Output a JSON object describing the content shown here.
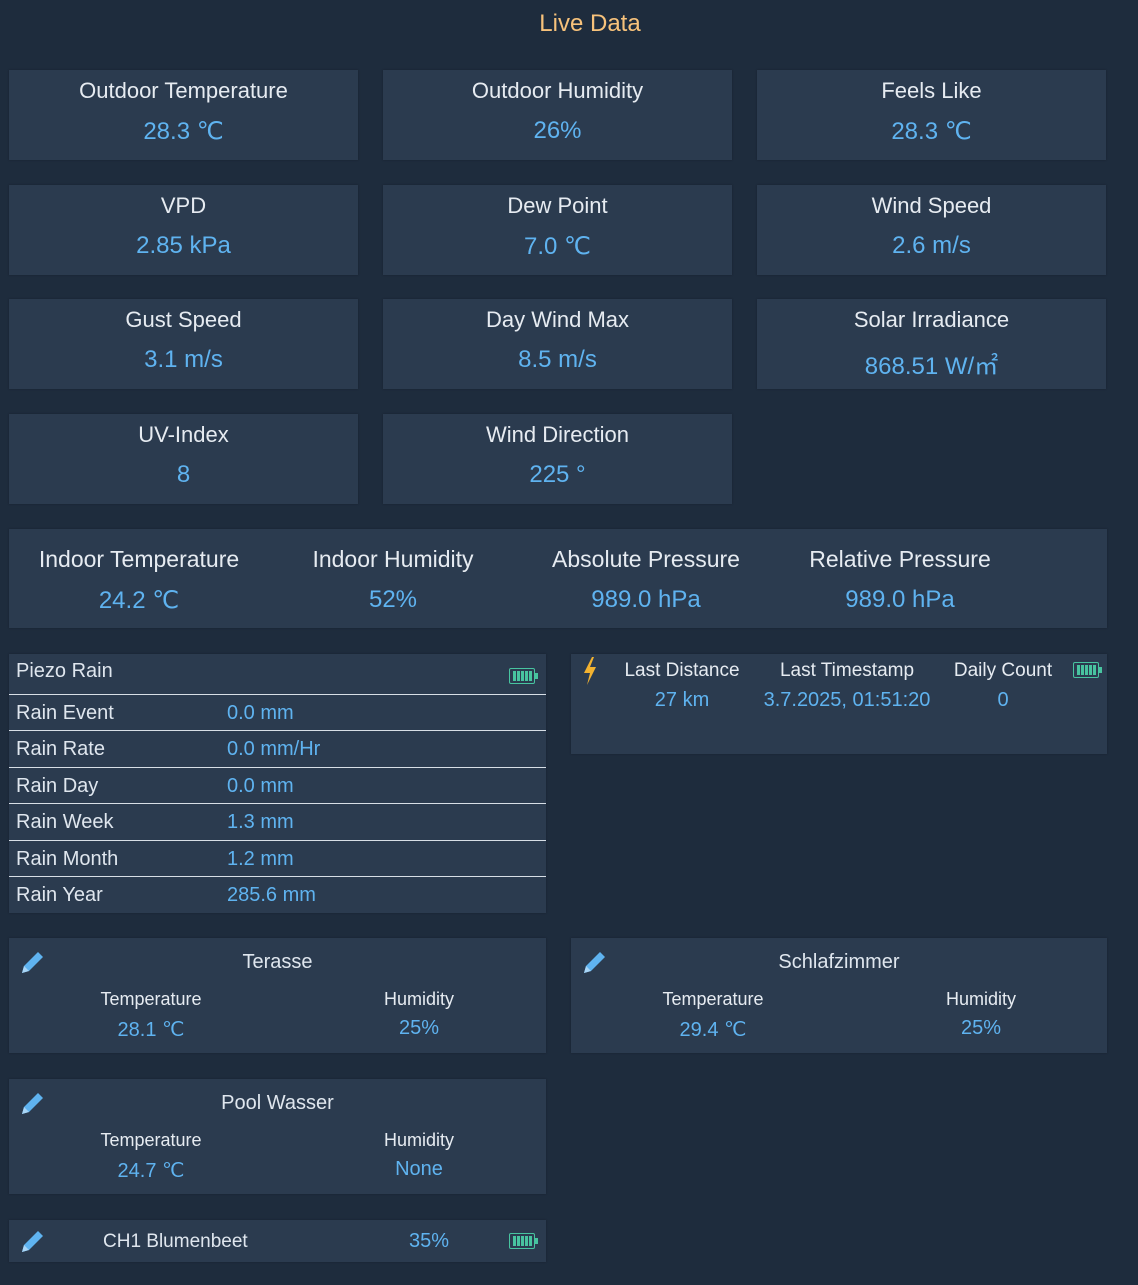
{
  "page_title": "Live Data",
  "tiles": [
    {
      "label": "Outdoor Temperature",
      "value": "28.3 ℃"
    },
    {
      "label": "Outdoor Humidity",
      "value": "26%"
    },
    {
      "label": "Feels Like",
      "value": "28.3 ℃"
    },
    {
      "label": "VPD",
      "value": "2.85 kPa"
    },
    {
      "label": "Dew Point",
      "value": "7.0 ℃"
    },
    {
      "label": "Wind Speed",
      "value": "2.6 m/s"
    },
    {
      "label": "Gust Speed",
      "value": "3.1 m/s"
    },
    {
      "label": "Day Wind Max",
      "value": "8.5 m/s"
    },
    {
      "label": "Solar Irradiance",
      "value": "868.51 W/㎡"
    },
    {
      "label": "UV-Index",
      "value": "8"
    },
    {
      "label": "Wind Direction",
      "value": "225 °"
    }
  ],
  "indoor": [
    {
      "label": "Indoor Temperature",
      "value": "24.2 ℃"
    },
    {
      "label": "Indoor Humidity",
      "value": "52%"
    },
    {
      "label": "Absolute Pressure",
      "value": "989.0 hPa"
    },
    {
      "label": "Relative Pressure",
      "value": "989.0 hPa"
    }
  ],
  "rain": {
    "title": "Piezo Rain",
    "battery_icon": "battery-full-icon",
    "rows": [
      {
        "label": "Rain Event",
        "value": "0.0 mm"
      },
      {
        "label": "Rain Rate",
        "value": "0.0 mm/Hr"
      },
      {
        "label": "Rain Day",
        "value": "0.0 mm"
      },
      {
        "label": "Rain Week",
        "value": "1.3 mm"
      },
      {
        "label": "Rain Month",
        "value": "1.2 mm"
      },
      {
        "label": "Rain Year",
        "value": "285.6 mm"
      }
    ]
  },
  "lightning": {
    "icon": "lightning-icon",
    "last_distance_label": "Last Distance",
    "last_distance": "27 km",
    "last_timestamp_label": "Last Timestamp",
    "last_timestamp": "3.7.2025, 01:51:20",
    "daily_count_label": "Daily Count",
    "daily_count": "0"
  },
  "sensors": [
    {
      "name": "Terasse",
      "temp_label": "Temperature",
      "temp": "28.1 ℃",
      "hum_label": "Humidity",
      "hum": "25%"
    },
    {
      "name": "Schlafzimmer",
      "temp_label": "Temperature",
      "temp": "29.4 ℃",
      "hum_label": "Humidity",
      "hum": "25%"
    },
    {
      "name": "Pool Wasser",
      "temp_label": "Temperature",
      "temp": "24.7 ℃",
      "hum_label": "Humidity",
      "hum": "None"
    }
  ],
  "soil": {
    "name": "CH1 Blumenbeet",
    "value": "35%"
  },
  "colors": {
    "background": "#1e2c3d",
    "card": "#2b3b4f",
    "accent": "#5fb3f0",
    "title": "#f7c27b",
    "battery": "#48c4a0",
    "bolt": "#f2b230"
  }
}
